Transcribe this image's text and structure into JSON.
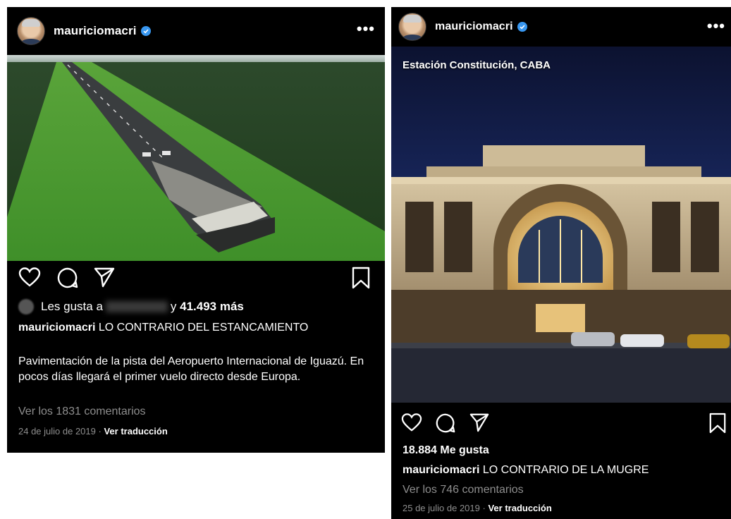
{
  "left_post": {
    "username": "mauriciomacri",
    "more_label": "•••",
    "likes_prefix": "Les gusta a",
    "likes_separator": "y",
    "likes_count": "41.493 más",
    "caption_title": "LO CONTRARIO DEL ESTANCAMIENTO",
    "caption_body": "Pavimentación de la pista del Aeropuerto Internacional de Iguazú. En pocos días llegará el primer vuelo directo desde Europa.",
    "comments_link": "Ver los 1831 comentarios",
    "date": "24 de julio de 2019",
    "separator": "·",
    "translate_label": "Ver traducción"
  },
  "right_post": {
    "username": "mauriciomacri",
    "more_label": "•••",
    "photo_overlay_text": "Estación Constitución, CABA",
    "likes": "18.884 Me gusta",
    "caption_title": "LO CONTRARIO DE LA MUGRE",
    "comments_link": "Ver los 746 comentarios",
    "date": "25 de julio de 2019",
    "separator": "·",
    "translate_label": "Ver traducción"
  },
  "icons": [
    "heart-icon",
    "comment-icon",
    "share-icon",
    "bookmark-icon",
    "verified-badge-icon"
  ],
  "colors": {
    "background": "#000000",
    "muted_text": "#8e8e8e",
    "verified": "#3897f0"
  }
}
